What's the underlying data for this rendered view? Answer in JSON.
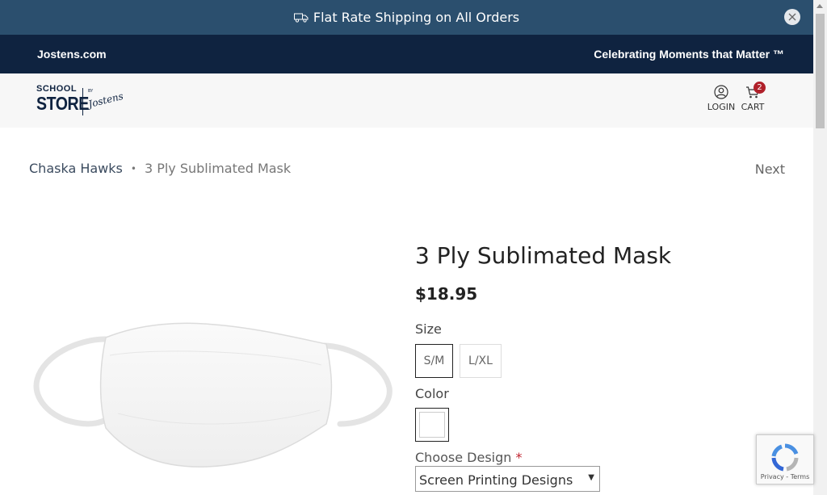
{
  "promo": {
    "text": "Flat Rate Shipping on All Orders",
    "truck_icon": "truck-icon",
    "close_icon": "close-icon"
  },
  "nav": {
    "left_link": "Jostens.com",
    "tagline": "Celebrating Moments that Matter ™"
  },
  "header": {
    "logo": {
      "school": "SCHOOL",
      "store": "STORE",
      "by": "BY",
      "jostens": "Jostens"
    },
    "login_label": "LOGIN",
    "cart_label": "CART",
    "cart_count": "2"
  },
  "breadcrumb": {
    "parent": "Chaska Hawks",
    "separator": "•",
    "current": "3 Ply Sublimated Mask"
  },
  "next_label": "Next",
  "product": {
    "title": "3 Ply Sublimated Mask",
    "price": "$18.95",
    "size_label": "Size",
    "sizes": [
      "S/M",
      "L/XL"
    ],
    "selected_size": "S/M",
    "color_label": "Color",
    "selected_color": "#ffffff",
    "design_label": "Choose Design",
    "required_marker": "*",
    "design_selected": "Screen Printing Designs"
  },
  "recaptcha": {
    "links": "Privacy - Terms"
  },
  "colors": {
    "promo_bg": "#2b4f6e",
    "nav_bg": "#0f2340",
    "header_bg": "#f7f7f7",
    "badge": "#b0202a"
  }
}
